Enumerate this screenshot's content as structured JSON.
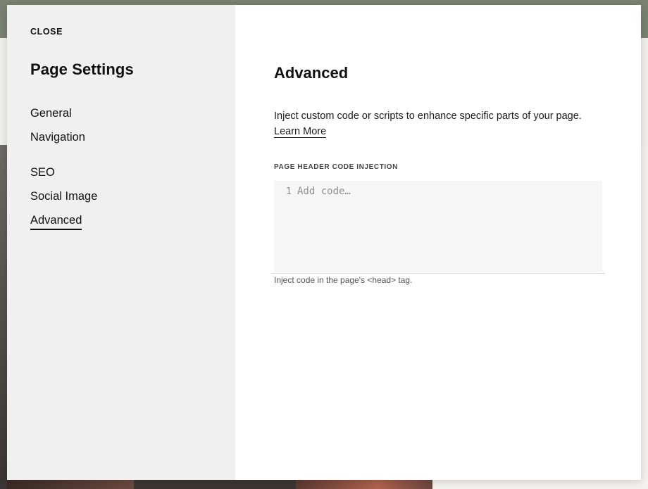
{
  "modal": {
    "close_label": "CLOSE",
    "title": "Page Settings",
    "nav": [
      {
        "label": "General"
      },
      {
        "label": "Navigation"
      },
      {
        "label": "SEO"
      },
      {
        "label": "Social Image"
      },
      {
        "label": "Advanced"
      }
    ],
    "active_nav": "Advanced"
  },
  "content": {
    "title": "Advanced",
    "description": "Inject custom code or scripts to enhance specific parts of your page.",
    "learn_more": "Learn More",
    "field_label": "PAGE HEADER CODE INJECTION",
    "line_number": "1",
    "placeholder": "Add code…",
    "helper": "Inject code in the page's <head> tag."
  },
  "colors": {
    "sidebar_bg": "#f0f0f0",
    "content_bg": "#ffffff",
    "editor_bg": "#f6f6f6",
    "text": "#111111"
  }
}
